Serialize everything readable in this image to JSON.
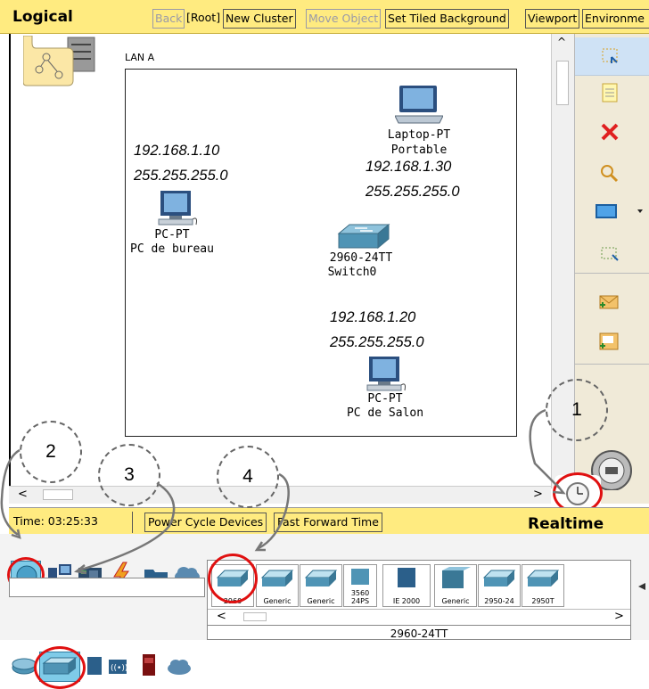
{
  "toolbar": {
    "logical": "Logical",
    "back": "Back",
    "root": "[Root]",
    "new_cluster": "New Cluster",
    "move_object": "Move Object",
    "set_tiled_background": "Set Tiled Background",
    "viewport": "Viewport",
    "environment": "Environme"
  },
  "canvas": {
    "lan_label": "LAN A",
    "devices": [
      {
        "model": "Laptop-PT",
        "name": "Portable",
        "ip": "192.168.1.30",
        "mask": "255.255.255.0"
      },
      {
        "model": "PC-PT",
        "name": "PC de bureau",
        "ip": "192.168.1.10",
        "mask": "255.255.255.0"
      },
      {
        "model": "2960-24TT",
        "name": "Switch0"
      },
      {
        "model": "PC-PT",
        "name": "PC de Salon",
        "ip": "192.168.1.20",
        "mask": "255.255.255.0"
      }
    ]
  },
  "timebar": {
    "time": "Time: 03:25:33",
    "power_cycle": "Power Cycle Devices",
    "fast_forward": "Fast Forward Time",
    "mode": "Realtime"
  },
  "device_list": {
    "items": [
      "2960",
      "Generic",
      "Generic",
      "3560 24PS",
      "IE 2000",
      "Generic",
      "2950-24",
      "2950T"
    ],
    "selected_label": "2960-24TT"
  },
  "callouts": [
    "1",
    "2",
    "3",
    "4"
  ],
  "colors": {
    "toolbar": "#ffeb80",
    "highlight": "#e01010",
    "delete": "#e02020"
  }
}
